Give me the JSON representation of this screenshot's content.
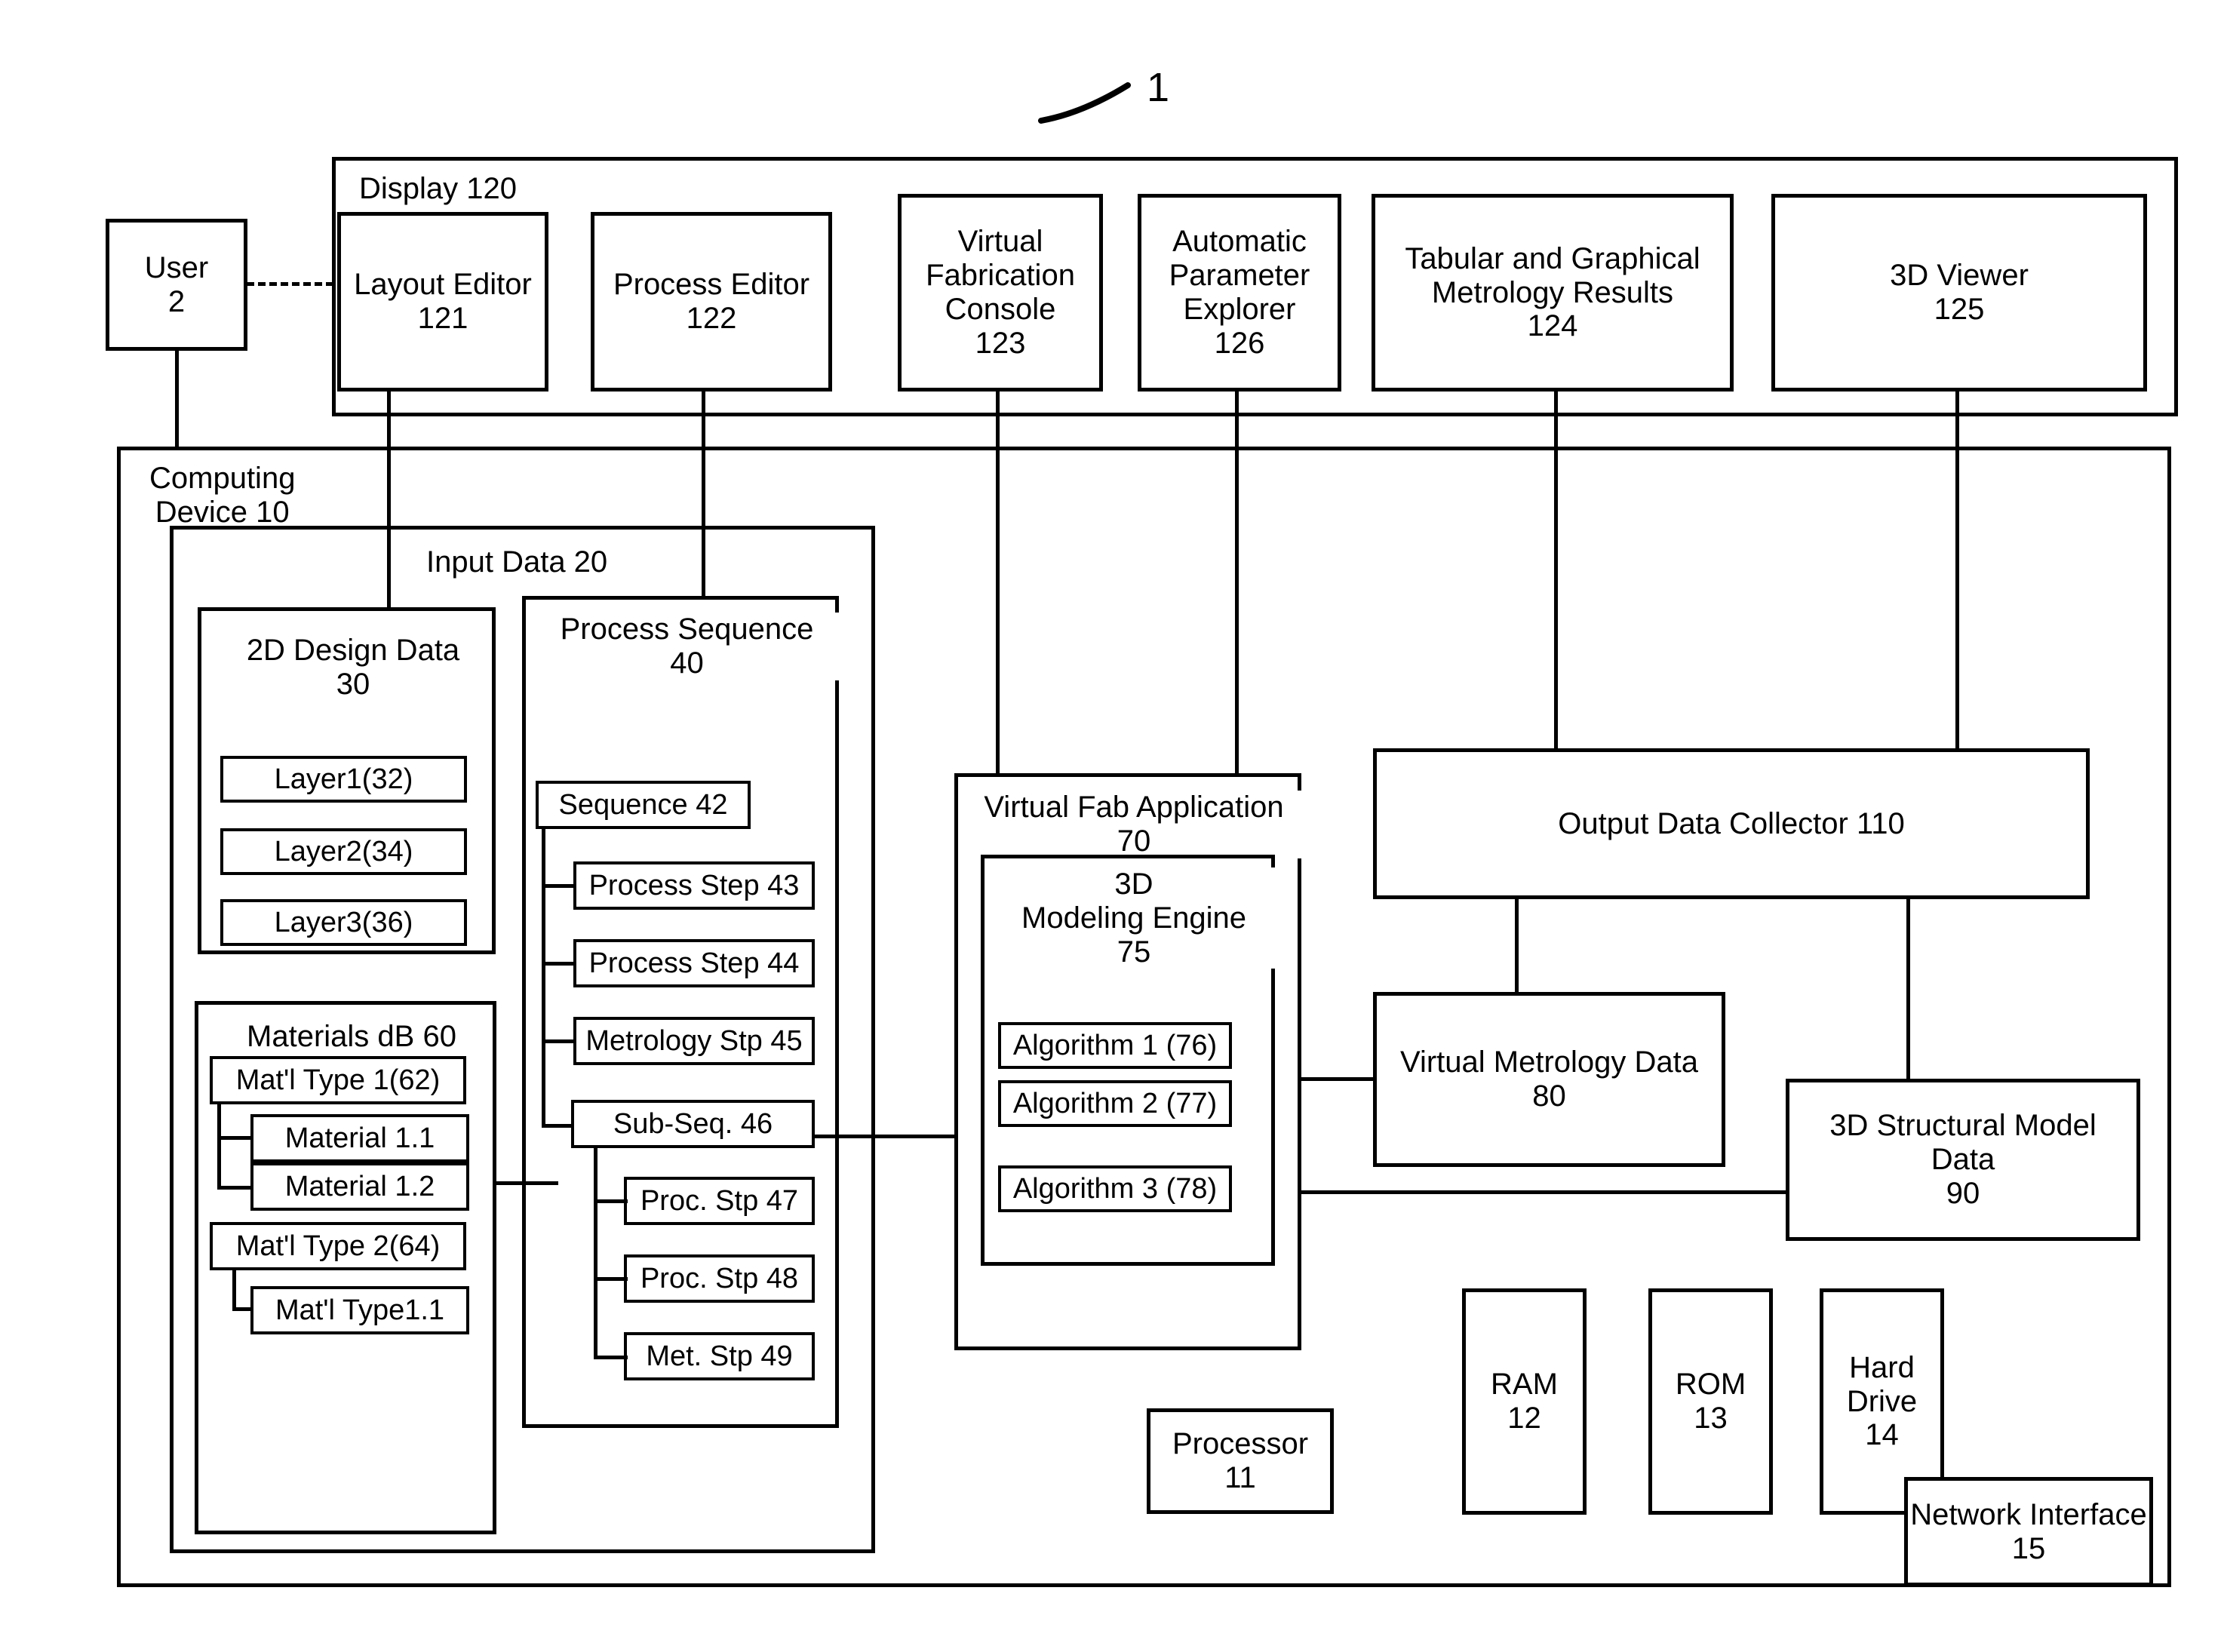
{
  "figure": {
    "number": "1"
  },
  "user": {
    "label": "User\n2"
  },
  "display": {
    "title": "Display 120",
    "panels": [
      {
        "label": "Layout Editor\n121"
      },
      {
        "label": "Process Editor\n122"
      },
      {
        "label": "Virtual\nFabrication\nConsole\n123"
      },
      {
        "label": "Automatic\nParameter\nExplorer\n126"
      },
      {
        "label": "Tabular and Graphical\nMetrology Results\n124"
      },
      {
        "label": "3D Viewer\n125"
      }
    ]
  },
  "computing_device": {
    "title": "Computing\nDevice 10"
  },
  "input_data": {
    "title": "Input Data 20",
    "design_data": {
      "title": "2D Design Data\n30",
      "layers": [
        {
          "label": "Layer1(32)"
        },
        {
          "label": "Layer2(34)"
        },
        {
          "label": "Layer3(36)"
        }
      ]
    },
    "materials_db": {
      "title": "Materials dB 60",
      "types": [
        {
          "label": "Mat'l Type 1(62)"
        },
        {
          "label": "Material 1.1"
        },
        {
          "label": "Material 1.2"
        },
        {
          "label": "Mat'l Type 2(64)"
        },
        {
          "label": "Mat'l Type1.1"
        }
      ]
    },
    "process_sequence": {
      "title": "Process Sequence\n40",
      "sequence": {
        "label": "Sequence 42"
      },
      "steps": [
        {
          "label": "Process Step 43"
        },
        {
          "label": "Process Step 44"
        },
        {
          "label": "Metrology Stp 45"
        }
      ],
      "sub_sequence": {
        "label": "Sub-Seq. 46"
      },
      "sub_steps": [
        {
          "label": "Proc. Stp 47"
        },
        {
          "label": "Proc. Stp 48"
        },
        {
          "label": "Met. Stp 49"
        }
      ]
    }
  },
  "virtual_fab": {
    "title": "Virtual Fab Application\n70",
    "engine": {
      "title": "3D\nModeling Engine\n75",
      "algorithms": [
        {
          "label": "Algorithm 1 (76)"
        },
        {
          "label": "Algorithm 2 (77)"
        },
        {
          "label": "Algorithm 3 (78)"
        }
      ]
    }
  },
  "output": {
    "collector": {
      "label": "Output Data Collector 110"
    },
    "virtual_metrology": {
      "label": "Virtual Metrology Data\n80"
    },
    "structural_model": {
      "label": "3D Structural Model\nData\n90"
    }
  },
  "hardware": {
    "processor": {
      "label": "Processor\n11"
    },
    "ram": {
      "label": "RAM\n12"
    },
    "rom": {
      "label": "ROM\n13"
    },
    "hard_drive": {
      "label": "Hard\nDrive\n14"
    },
    "network_interface": {
      "label": "Network Interface\n15"
    }
  }
}
